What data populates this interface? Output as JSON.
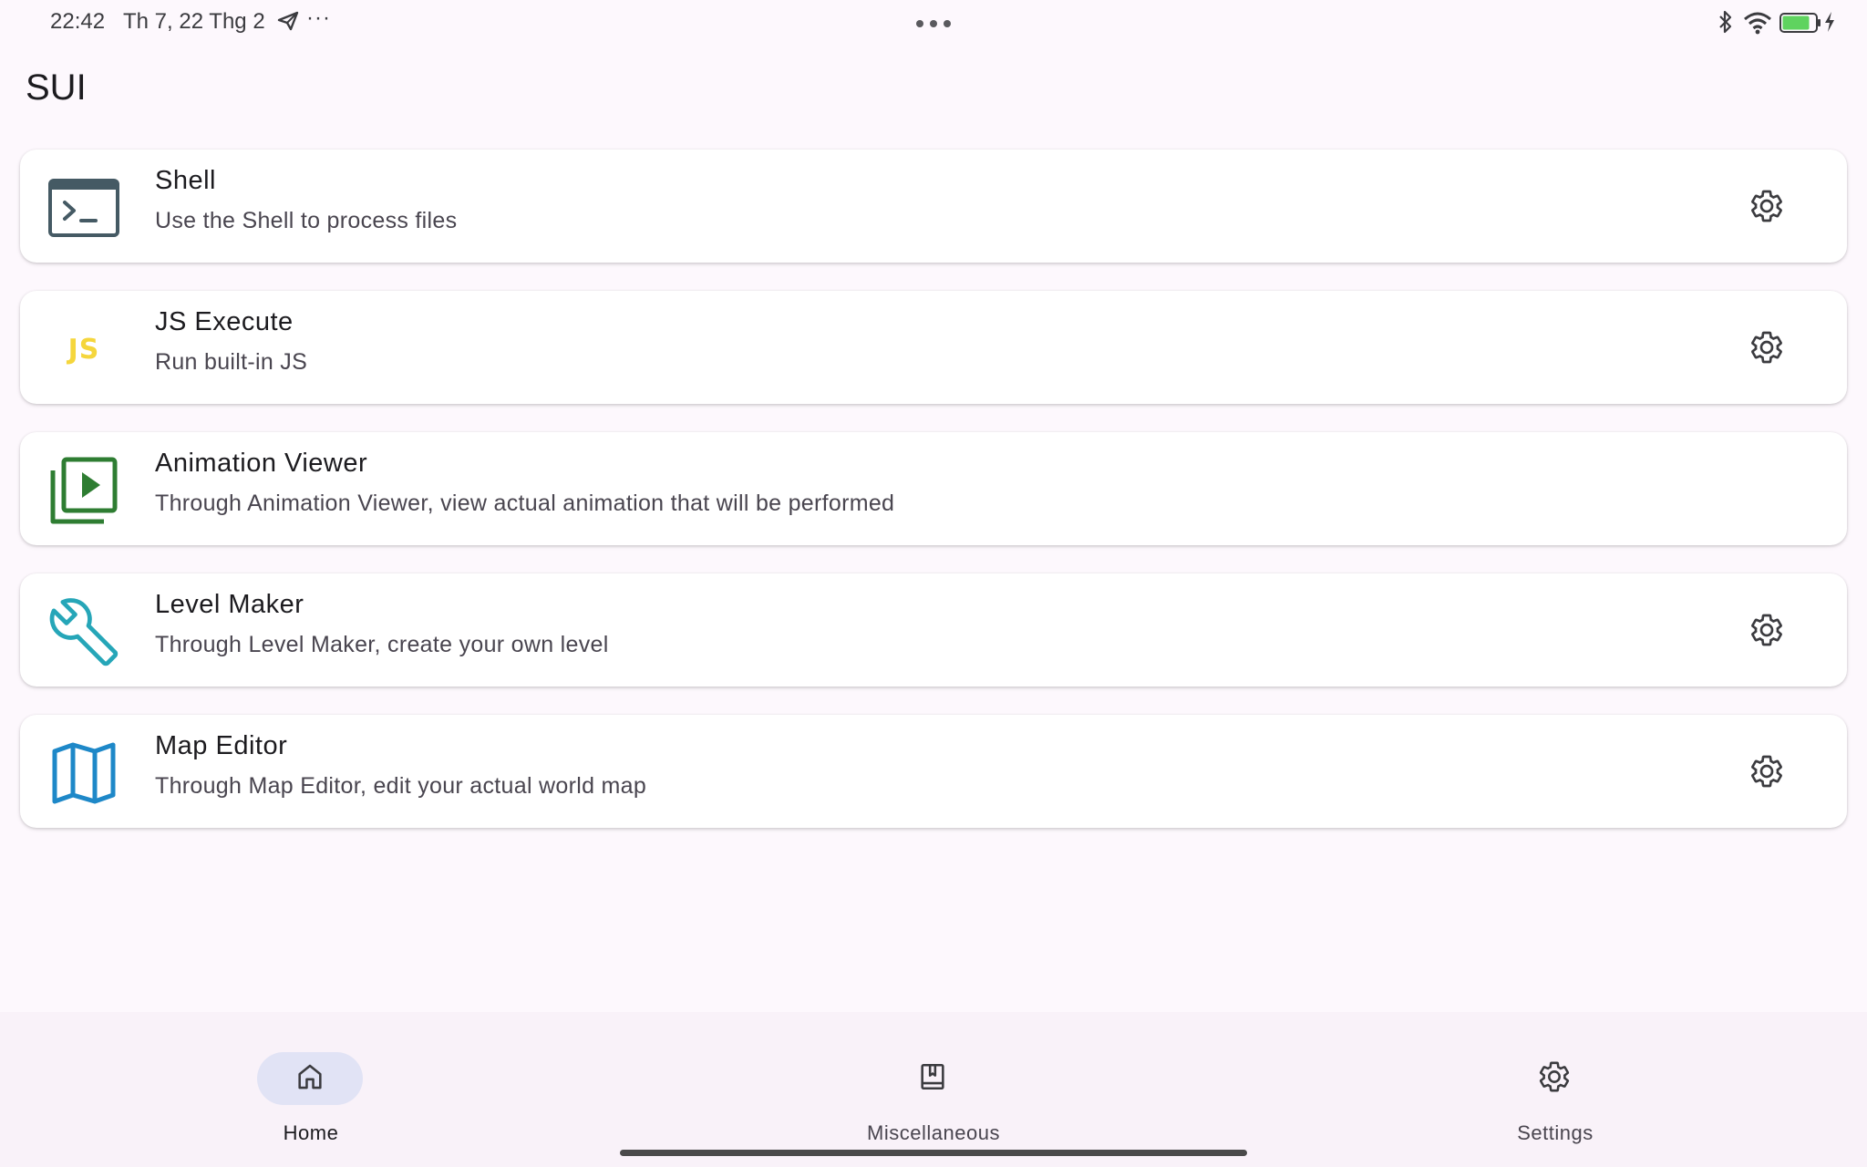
{
  "status_bar": {
    "time": "22:42",
    "date": "Th 7, 22 Thg 2",
    "more": "···",
    "battery_level": "78",
    "icons": [
      "send-icon",
      "more-dots-icon",
      "bluetooth-icon",
      "wifi-icon",
      "battery-icon",
      "charging-icon"
    ]
  },
  "app": {
    "title": "SUI"
  },
  "cards": [
    {
      "title": "Shell",
      "subtitle": "Use the Shell to process files",
      "icon": "terminal-icon",
      "has_settings": true
    },
    {
      "title": "JS Execute",
      "subtitle": "Run built-in JS",
      "icon": "js-icon",
      "icon_text": "JS",
      "has_settings": true
    },
    {
      "title": "Animation Viewer",
      "subtitle": "Through Animation Viewer, view actual animation that will be performed",
      "icon": "animation-icon",
      "has_settings": false
    },
    {
      "title": "Level Maker",
      "subtitle": "Through Level Maker, create your own level",
      "icon": "wrench-icon",
      "has_settings": true
    },
    {
      "title": "Map Editor",
      "subtitle": "Through Map Editor, edit your actual world map",
      "icon": "map-icon",
      "has_settings": true
    }
  ],
  "bottom_nav": {
    "items": [
      {
        "label": "Home",
        "icon": "home-icon",
        "active": true
      },
      {
        "label": "Miscellaneous",
        "icon": "bookmark-book-icon",
        "active": false
      },
      {
        "label": "Settings",
        "icon": "gear-icon",
        "active": false
      }
    ]
  },
  "colors": {
    "background": "#fdf8fd",
    "nav_background": "#f9f2f9",
    "nav_active_pill": "#e1e3f5",
    "terminal_icon": "#455a64",
    "js_icon": "#f5d63c",
    "animation_icon": "#2e7d32",
    "wrench_icon": "#26a6b8",
    "map_icon": "#1e88c8"
  }
}
